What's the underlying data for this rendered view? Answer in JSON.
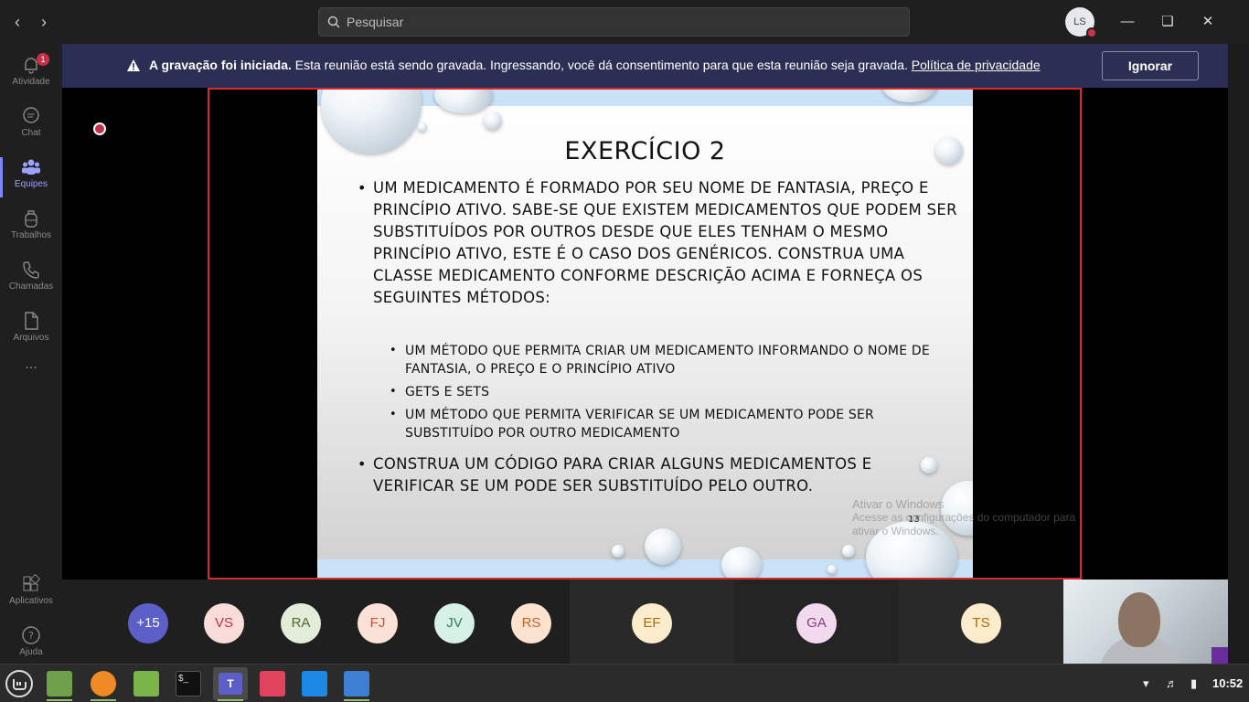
{
  "titlebar": {
    "search_placeholder": "Pesquisar",
    "user_initials": "LS",
    "back": "‹",
    "forward": "›"
  },
  "rail": {
    "items": [
      {
        "label": "Atividade",
        "badge": "1"
      },
      {
        "label": "Chat"
      },
      {
        "label": "Equipes"
      },
      {
        "label": "Trabalhos"
      },
      {
        "label": "Chamadas"
      },
      {
        "label": "Arquivos"
      },
      {
        "label": "..."
      },
      {
        "label": "Aplicativos"
      },
      {
        "label": "Ajuda"
      }
    ]
  },
  "banner": {
    "bold": "A gravação foi iniciada.",
    "text": " Esta reunião está sendo gravada. Ingressando, você dá consentimento para que esta reunião seja gravada. ",
    "link": "Política de privacidade",
    "ignore": "Ignorar"
  },
  "slide": {
    "title": "EXERCÍCIO 2",
    "para1": [
      "Um medicamento é formado por seu nome de fantasia, preço e",
      "princípio ativo. Sabe-se que existem medicamentos que podem ser",
      "substituídos por outros desde que eles tenham o mesmo",
      "princípio ativo, este é o caso dos genéricos. Construa uma",
      "classe medicamento conforme descrição acima e forneça os",
      "seguintes métodos:"
    ],
    "sub1": [
      "Um método que permita criar um medicamento informando o nome de",
      "fantasia, o preço e o princípio ativo"
    ],
    "sub2": [
      "Gets e sets"
    ],
    "sub3": [
      "Um método que permita verificar se um medicamento pode ser",
      "substituído por outro medicamento"
    ],
    "para2": [
      "Construa um código para criar alguns medicamentos e",
      "verificar se um pode ser substituído pelo outro."
    ],
    "page_number": "13",
    "watermark_title": "Ativar o Windows",
    "watermark_line2": "Acesse as configurações do computador para",
    "watermark_line3": "ativar o Windows."
  },
  "participants": [
    {
      "initials": "+15",
      "bg": "#5b5fc7",
      "fg": "#ffffff"
    },
    {
      "initials": "VS",
      "bg": "#f9dcd9",
      "fg": "#c4314b"
    },
    {
      "initials": "RA",
      "bg": "#e3ecd8",
      "fg": "#4e6a2e"
    },
    {
      "initials": "FJ",
      "bg": "#fbe1d8",
      "fg": "#c5553a"
    },
    {
      "initials": "JV",
      "bg": "#d6f0e6",
      "fg": "#2e7d5b"
    },
    {
      "initials": "RS",
      "bg": "#fde2cf",
      "fg": "#c2622a"
    },
    {
      "initials": "EF",
      "bg": "#fbeccb",
      "fg": "#a96d08"
    },
    {
      "initials": "GA",
      "bg": "#f1d9ee",
      "fg": "#8a3b85"
    },
    {
      "initials": "TS",
      "bg": "#fbeccb",
      "fg": "#a96d08"
    }
  ],
  "taskbar": {
    "clock": "10:52"
  }
}
